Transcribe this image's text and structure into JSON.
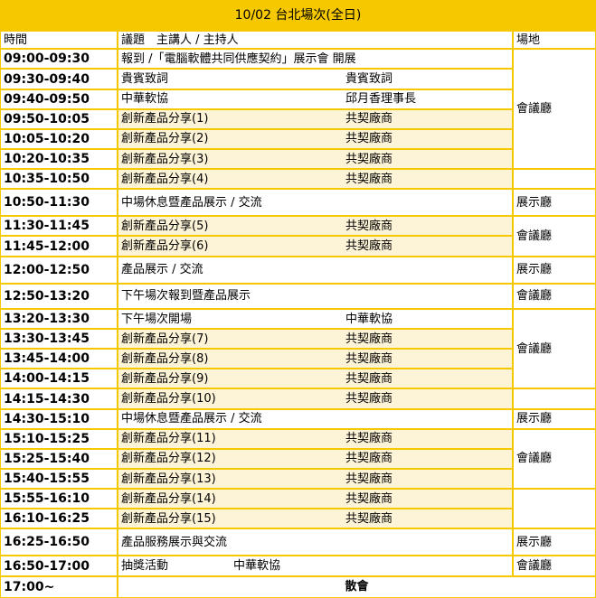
{
  "title": "10/02 台北場次(全日)",
  "headers": {
    "time": "時間",
    "topic": "議題　主講人 / 主持人",
    "venue": "場地"
  },
  "rows": [
    {
      "time": "09:00-09:30",
      "topic": "報到 /「電腦軟體共同供應契約」展示會 開展",
      "speaker": ""
    },
    {
      "time": "09:30-09:40",
      "topic": "貴賓致詞",
      "speaker": "貴賓致詞"
    },
    {
      "time": "09:40-09:50",
      "topic": "中華軟協",
      "speaker": "邱月香理事長"
    },
    {
      "time": "09:50-10:05",
      "topic": "創新產品分享(1)",
      "speaker": "共契廠商"
    },
    {
      "time": "10:05-10:20",
      "topic": "創新產品分享(2)",
      "speaker": "共契廠商"
    },
    {
      "time": "10:20-10:35",
      "topic": "創新產品分享(3)",
      "speaker": "共契廠商"
    },
    {
      "time": "10:35-10:50",
      "topic": "創新產品分享(4)",
      "speaker": "共契廠商"
    },
    {
      "time": "10:50-11:30",
      "topic": "中場休息暨產品展示 / 交流",
      "speaker": ""
    },
    {
      "time": "11:30-11:45",
      "topic": "創新產品分享(5)",
      "speaker": "共契廠商"
    },
    {
      "time": "11:45-12:00",
      "topic": "創新產品分享(6)",
      "speaker": "共契廠商"
    },
    {
      "time": "12:00-12:50",
      "topic": "產品展示 / 交流",
      "speaker": ""
    },
    {
      "time": "12:50-13:20",
      "topic": "下午場次報到暨產品展示",
      "speaker": ""
    },
    {
      "time": "13:20-13:30",
      "topic": "下午場次開場",
      "speaker": "中華軟協"
    },
    {
      "time": "13:30-13:45",
      "topic": "創新產品分享(7)",
      "speaker": "共契廠商"
    },
    {
      "time": "13:45-14:00",
      "topic": "創新產品分享(8)",
      "speaker": "共契廠商"
    },
    {
      "time": "14:00-14:15",
      "topic": "創新產品分享(9)",
      "speaker": "共契廠商"
    },
    {
      "time": "14:15-14:30",
      "topic": "創新產品分享(10)",
      "speaker": "共契廠商"
    },
    {
      "time": "14:30-15:10",
      "topic": "中場休息暨產品展示 / 交流",
      "speaker": ""
    },
    {
      "time": "15:10-15:25",
      "topic": "創新產品分享(11)",
      "speaker": "共契廠商"
    },
    {
      "time": "15:25-15:40",
      "topic": "創新產品分享(12)",
      "speaker": "共契廠商"
    },
    {
      "time": "15:40-15:55",
      "topic": "創新產品分享(13)",
      "speaker": "共契廠商"
    },
    {
      "time": "15:55-16:10",
      "topic": "創新產品分享(14)",
      "speaker": "共契廠商"
    },
    {
      "time": "16:10-16:25",
      "topic": "創新產品分享(15)",
      "speaker": "共契廠商"
    },
    {
      "time": "16:25-16:50",
      "topic": "產品服務展示與交流",
      "speaker": ""
    },
    {
      "time": "16:50-17:00",
      "topic": "抽獎活動",
      "speaker": "中華軟協"
    },
    {
      "time": "17:00~",
      "topic": "散會",
      "speaker": ""
    }
  ],
  "venues": {
    "v1": "會議廳",
    "v2": "展示廳",
    "v3": "會議廳",
    "v4": "展示廳",
    "v5": "會議廳",
    "v6": "會議廳",
    "v7": "展示廳",
    "v8": "會議廳",
    "v9": "展示廳",
    "v10": "會議廳"
  }
}
